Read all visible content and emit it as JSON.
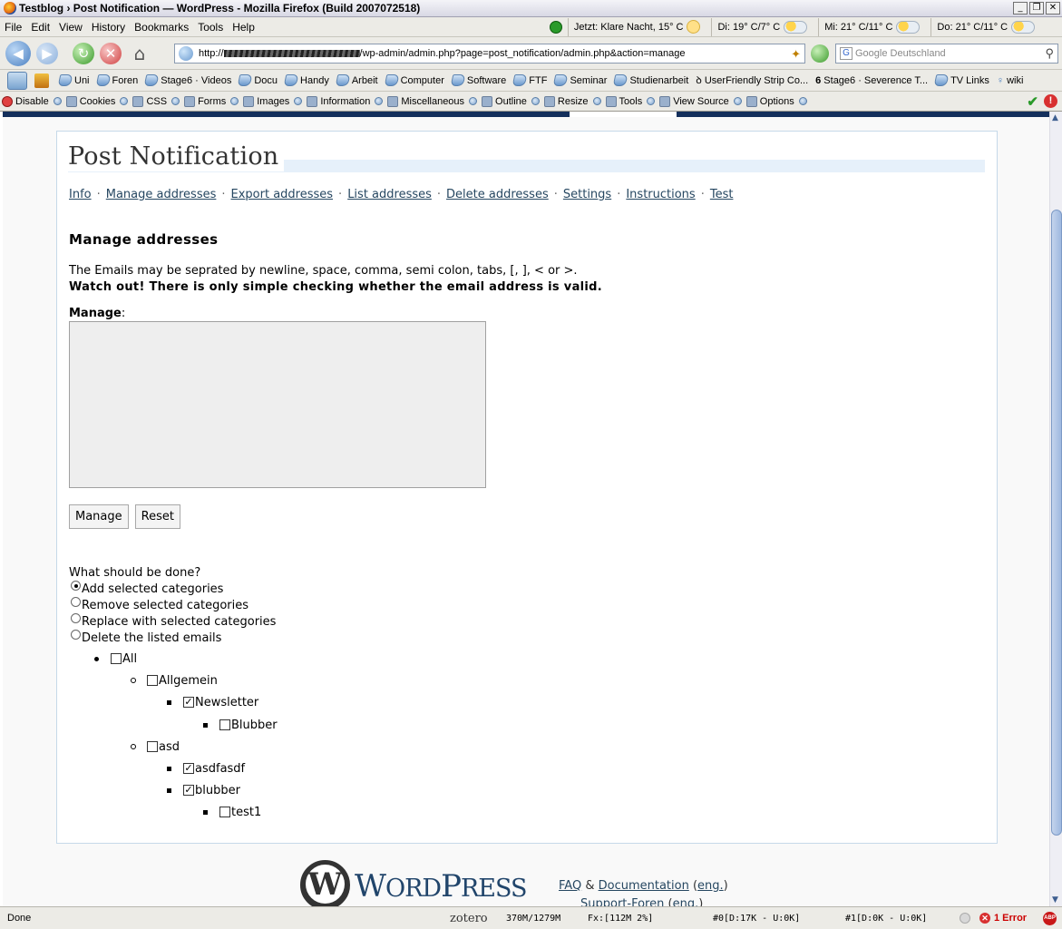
{
  "window": {
    "title": "Testblog › Post Notification — WordPress - Mozilla Firefox (Build 2007072518)",
    "buttons": [
      "_",
      "❐",
      "✕"
    ]
  },
  "menu": {
    "items": [
      "File",
      "Edit",
      "View",
      "History",
      "Bookmarks",
      "Tools",
      "Help"
    ]
  },
  "weather": {
    "now": "Jetzt: Klare Nacht, 15° C",
    "tue": "Di: 19° C/7° C",
    "wed": "Mi: 21° C/11° C",
    "thu": "Do: 21° C/11° C"
  },
  "nav": {
    "url_prefix": "http://",
    "url_suffix": "/wp-admin/admin.php?page=post_notification/admin.php&action=manage",
    "search_placeholder": "Google Deutschland"
  },
  "bookmarks": [
    "Uni",
    "Foren",
    "Stage6 · Videos",
    "Docu",
    "Handy",
    "Arbeit",
    "Computer",
    "Software",
    "FTF",
    "Seminar",
    "Studienarbeit",
    "UserFriendly Strip Co...",
    "Stage6 · Severence T...",
    "TV Links",
    "wiki"
  ],
  "devtools": [
    "Disable",
    "Cookies",
    "CSS",
    "Forms",
    "Images",
    "Information",
    "Miscellaneous",
    "Outline",
    "Resize",
    "Tools",
    "View Source",
    "Options"
  ],
  "page": {
    "title": "Post Notification",
    "subnav": [
      "Info",
      "Manage addresses",
      "Export addresses",
      "List addresses",
      "Delete addresses",
      "Settings",
      "Instructions",
      "Test"
    ],
    "heading": "Manage addresses",
    "intro": "The Emails may be seprated by newline, space, comma, semi colon, tabs, [, ], < or >.",
    "warning": "Watch out! There is only simple checking whether the email address is valid.",
    "manage_label": "Manage",
    "manage_colon": ":",
    "manage_value": "",
    "buttons": {
      "manage": "Manage",
      "reset": "Reset"
    },
    "question": "What should be done?",
    "options": [
      {
        "label": "Add selected categories",
        "selected": true
      },
      {
        "label": "Remove selected categories",
        "selected": false
      },
      {
        "label": "Replace with selected categories",
        "selected": false
      },
      {
        "label": "Delete the listed emails",
        "selected": false
      }
    ],
    "categories": [
      {
        "label": "All",
        "checked": false,
        "level": 0
      },
      {
        "label": "Allgemein",
        "checked": false,
        "level": 1
      },
      {
        "label": "Newsletter",
        "checked": true,
        "level": 2
      },
      {
        "label": "Blubber",
        "checked": false,
        "level": 3
      },
      {
        "label": "asd",
        "checked": false,
        "level": 1
      },
      {
        "label": "asdfasdf",
        "checked": true,
        "level": 2
      },
      {
        "label": "blubber",
        "checked": true,
        "level": 2
      },
      {
        "label": "test1",
        "checked": false,
        "level": 3
      }
    ]
  },
  "footer": {
    "logo_big": "W",
    "logo_rest": "ORD",
    "logo_p": "P",
    "logo_ress": "RESS",
    "faq": "FAQ",
    "amp": "&",
    "documentation": "Documentation",
    "eng1": "eng.",
    "support": "Support-Foren",
    "eng2": "eng."
  },
  "status": {
    "text": "Done",
    "zotero": "zotero",
    "mem": "370M/1279M",
    "fx": "Fx:[112M  2%]",
    "net0": "#0[D:17K - U:0K]",
    "net1": "#1[D:0K - U:0K]",
    "errors": "1 Error",
    "abp": "ABP"
  }
}
